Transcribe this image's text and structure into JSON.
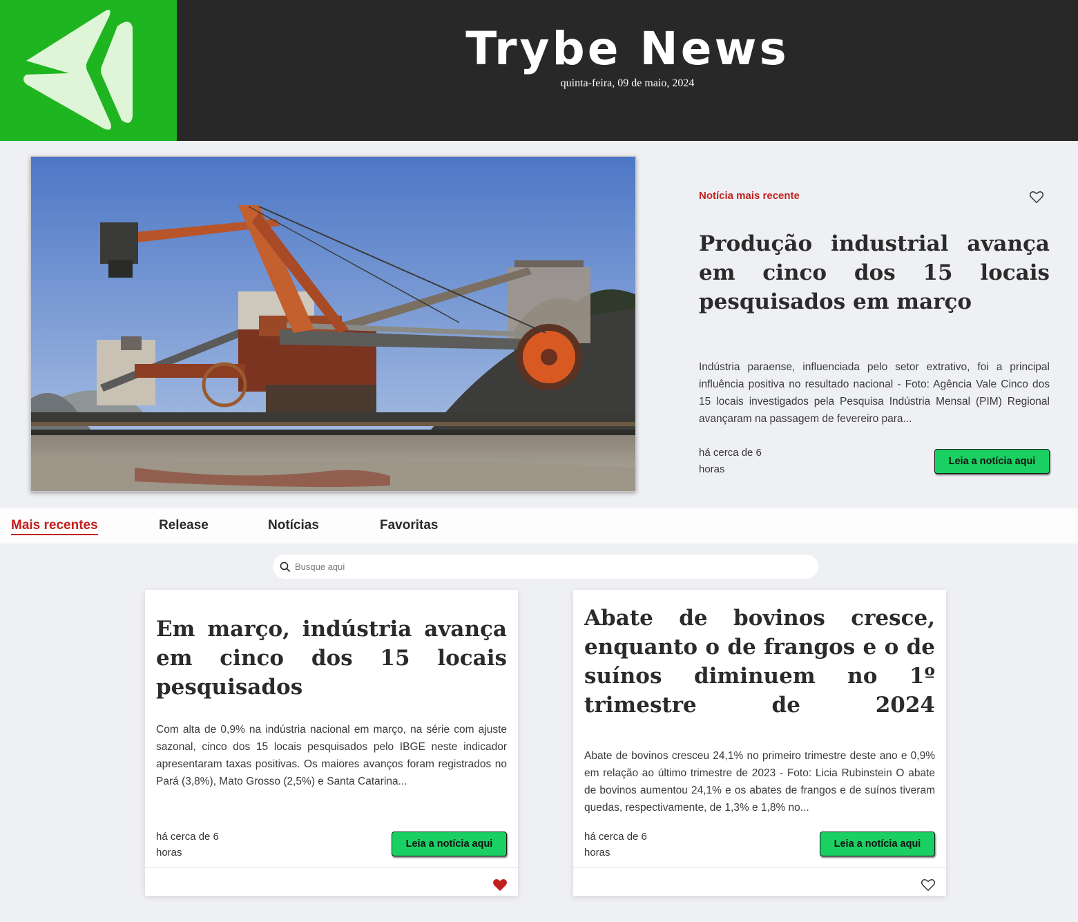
{
  "header": {
    "title": "Trybe News",
    "date": "quinta-feira, 09 de maio, 2024",
    "logo_icon": "paper-plane-logo",
    "colors": {
      "brand_green": "#1fb520",
      "header_bg": "#282828"
    }
  },
  "hero": {
    "label": "Notícia mais recente",
    "title": "Produção industrial avança em cinco dos 15 locais pesquisados em março",
    "summary": "Indústria paraense, influenciada pelo setor extrativo, foi a principal influência positiva no resultado nacional - Foto: Agência Vale Cinco dos 15 locais investigados pela Pesquisa Indústria Mensal (PIM) Regional avançaram na passagem de fevereiro para...",
    "time": "há cerca de 6 horas",
    "button": "Leia a notícia aqui",
    "favorite_icon": "heart-outline-icon",
    "favorited": false
  },
  "tabs": [
    {
      "label": "Mais recentes",
      "active": true
    },
    {
      "label": "Release",
      "active": false
    },
    {
      "label": "Notícias",
      "active": false
    },
    {
      "label": "Favoritas",
      "active": false
    }
  ],
  "search": {
    "placeholder": "Busque aqui",
    "value": "",
    "icon": "search-icon"
  },
  "cards": [
    {
      "title": "Em março, indústria avança em cinco dos 15 locais pesquisados",
      "summary": "Com alta de 0,9% na indústria nacional em março, na série com ajuste sazonal, cinco dos 15 locais pesquisados pelo IBGE neste indicador apresentaram taxas positivas. Os maiores avanços foram registrados no Pará (3,8%), Mato Grosso (2,5%) e Santa Catarina...",
      "time": "há cerca de 6 horas",
      "button": "Leia a notícia aqui",
      "favorited": true
    },
    {
      "title": "Abate de bovinos cresce, enquanto o de frangos e o de suínos diminuem no 1º trimestre de 2024",
      "summary": "Abate de bovinos cresceu 24,1% no primeiro trimestre deste ano e 0,9% em relação ao último trimestre de 2023 - Foto: Licia Rubinstein O abate de bovinos aumentou 24,1% e os abates de frangos e de suínos tiveram quedas, respectivamente, de 1,3% e 1,8% no...",
      "time": "há cerca de 6 horas",
      "button": "Leia a notícia aqui",
      "favorited": false
    }
  ],
  "colors": {
    "accent_red": "#c0201e",
    "button_green": "#1ad063"
  }
}
